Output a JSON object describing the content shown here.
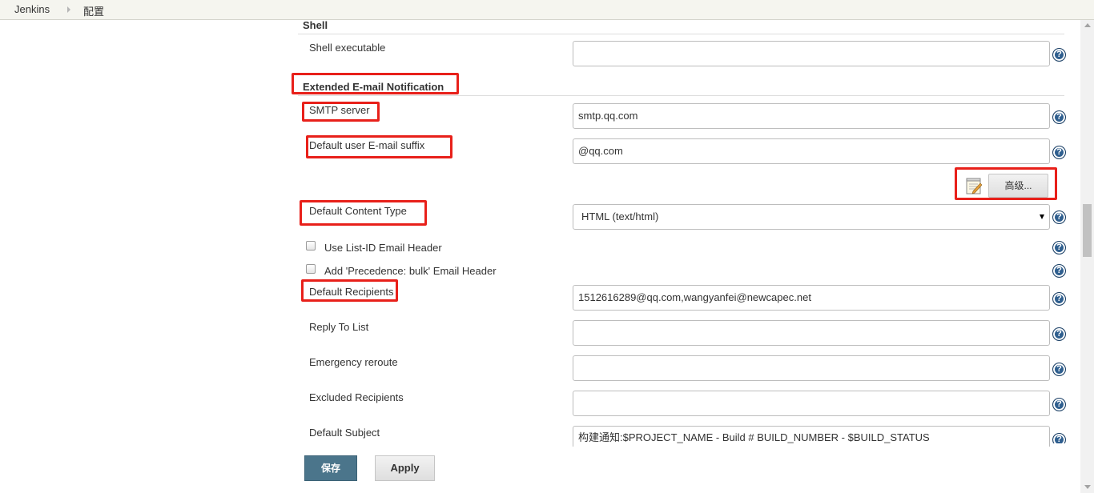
{
  "breadcrumb": {
    "root": "Jenkins",
    "current": "配置"
  },
  "sections": {
    "shell": {
      "title": "Shell",
      "shell_executable_label": "Shell executable",
      "shell_executable_value": ""
    },
    "email": {
      "title": "Extended E-mail Notification",
      "smtp_server_label": "SMTP server",
      "smtp_server_value": "smtp.qq.com",
      "email_suffix_label": "Default user E-mail suffix",
      "email_suffix_value": "@qq.com",
      "advanced_label": "高级...",
      "content_type_label": "Default Content Type",
      "content_type_value": "HTML (text/html)",
      "list_id_label": "Use List-ID Email Header",
      "list_id_checked": false,
      "precedence_label": "Add 'Precedence: bulk' Email Header",
      "precedence_checked": false,
      "recipients_label": "Default Recipients",
      "recipients_value": "1512616289@qq.com,wangyanfei@newcapec.net",
      "reply_to_label": "Reply To List",
      "reply_to_value": "",
      "emergency_label": "Emergency reroute",
      "emergency_value": "",
      "excluded_label": "Excluded Recipients",
      "excluded_value": "",
      "subject_label": "Default Subject",
      "subject_value": "构建通知:$PROJECT_NAME - Build # BUILD_NUMBER - $BUILD_STATUS"
    }
  },
  "help_glyph": "?",
  "buttons": {
    "save": "保存",
    "apply": "Apply"
  },
  "colors": {
    "annotation": "#e8201a",
    "save_button": "#4b758b",
    "help_icon": "#2f5f8f"
  }
}
